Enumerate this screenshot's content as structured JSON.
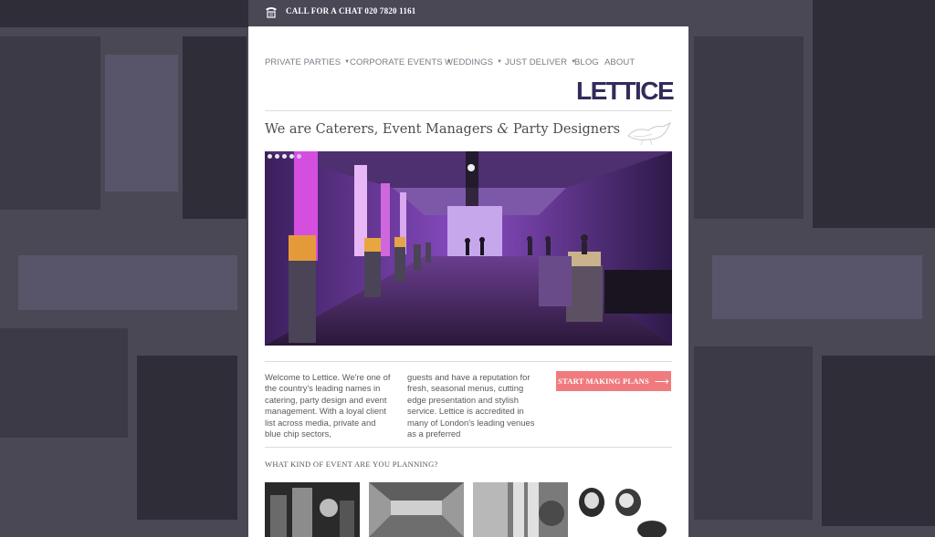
{
  "header": {
    "call_text": "CALL FOR A CHAT 020 7820 1161",
    "phone_icon": "phone-icon"
  },
  "nav": {
    "items": [
      {
        "label": "PRIVATE PARTIES",
        "has_dropdown": true
      },
      {
        "label": "CORPORATE EVENTS",
        "has_dropdown": true
      },
      {
        "label": "WEDDINGS",
        "has_dropdown": true
      },
      {
        "label": "JUST DELIVER",
        "has_dropdown": true
      },
      {
        "label": "BLOG",
        "has_dropdown": false
      },
      {
        "label": "ABOUT",
        "has_dropdown": false
      }
    ]
  },
  "brand": {
    "logo_text": "LETTICE",
    "color": "#312c5a"
  },
  "tagline": {
    "prefix": "We are Caterers, Event Managers ",
    "amp": "&",
    "suffix": " Party Designers"
  },
  "slider": {
    "dot_count": 5,
    "active_index": 4,
    "icon": "slideshow-image"
  },
  "intro": {
    "column1": "Welcome to Lettice. We're one of the country's leading names in catering, party design and event management. With a loyal client list across media, private and blue chip sectors,",
    "column2": "guests and have a reputation for fresh, seasonal menus, cutting edge presentation and stylish service. Lettice is accredited in many of London's leading venues as a preferred"
  },
  "cta": {
    "label": "START MAKING PLANS",
    "arrow": "⟶",
    "color": "#f07b7e"
  },
  "events": {
    "question": "WHAT KIND OF EVENT ARE YOU PLANNING?",
    "thumbnails": [
      "party-thumbnail",
      "corporate-thumbnail",
      "wedding-thumbnail",
      "deliver-thumbnail"
    ]
  },
  "colors": {
    "background": "#4b4856",
    "accent": "#f07b7e",
    "brand": "#312c5a"
  }
}
